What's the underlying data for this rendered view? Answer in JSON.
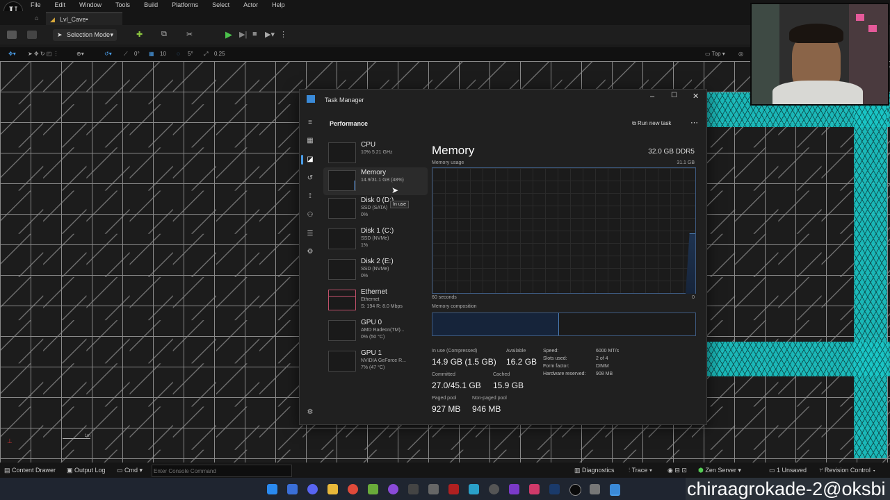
{
  "editor": {
    "menu": [
      "File",
      "Edit",
      "Window",
      "Tools",
      "Build",
      "Platforms",
      "Select",
      "Actor",
      "Help"
    ],
    "level_tab": "Lvl_Cave•",
    "selection_mode": "Selection Mode",
    "view_values": {
      "rot": "0°",
      "grid": "10",
      "angle": "5°",
      "scale": "0.25"
    },
    "view_mode": "Top",
    "scale_marker": "1m"
  },
  "statusbar": {
    "content_drawer": "Content Drawer",
    "output_log": "Output Log",
    "cmd": "Cmd",
    "console_placeholder": "Enter Console Command",
    "diagnostics": "Diagnostics",
    "trace": "Trace",
    "zen_server": "Zen Server",
    "unsaved": "1 Unsaved",
    "revision_control": "Revision Control"
  },
  "watermark": "chiraagrokade-2@oksbi",
  "task_manager": {
    "title": "Task Manager",
    "section": "Performance",
    "run_new_task": "Run new task",
    "devices": [
      {
        "name": "CPU",
        "line1": "10% 5.21 GHz",
        "line2": ""
      },
      {
        "name": "Memory",
        "line1": "14.9/31.1 GB (48%)",
        "line2": ""
      },
      {
        "name": "Disk 0 (D:)",
        "line1": "SSD (SATA)",
        "line2": "0%"
      },
      {
        "name": "Disk 1 (C:)",
        "line1": "SSD (NVMe)",
        "line2": "1%"
      },
      {
        "name": "Disk 2 (E:)",
        "line1": "SSD (NVMe)",
        "line2": "0%"
      },
      {
        "name": "Ethernet",
        "line1": "Ethernet",
        "line2": "S: 194 R: 8.0 Mbps"
      },
      {
        "name": "GPU 0",
        "line1": "AMD Radeon(TM)...",
        "line2": "0% (50 °C)"
      },
      {
        "name": "GPU 1",
        "line1": "NVIDIA GeForce R...",
        "line2": "7% (47 °C)"
      }
    ],
    "tooltip": "In use",
    "memory": {
      "title": "Memory",
      "capacity": "32.0 GB DDR5",
      "usage_label": "Memory usage",
      "usage_max": "31.1 GB",
      "time_label": "60 seconds",
      "time_end": "0",
      "composition_label": "Memory composition",
      "in_use_fraction": 0.48,
      "stats": {
        "in_use_label": "In use (Compressed)",
        "in_use": "14.9 GB (1.5 GB)",
        "available_label": "Available",
        "available": "16.2 GB",
        "committed_label": "Committed",
        "committed": "27.0/45.1 GB",
        "cached_label": "Cached",
        "cached": "15.9 GB",
        "paged_label": "Paged pool",
        "paged": "927 MB",
        "nonpaged_label": "Non-paged pool",
        "nonpaged": "946 MB"
      },
      "specs": [
        {
          "k": "Speed:",
          "v": "6000 MT/s"
        },
        {
          "k": "Slots used:",
          "v": "2 of 4"
        },
        {
          "k": "Form factor:",
          "v": "DIMM"
        },
        {
          "k": "Hardware reserved:",
          "v": "908 MB"
        }
      ]
    }
  },
  "colors": {
    "accent": "#4a9de8",
    "mesh": "#1ac8c8",
    "graph_border": "#3d5a80",
    "ethernet": "#c0506a"
  }
}
